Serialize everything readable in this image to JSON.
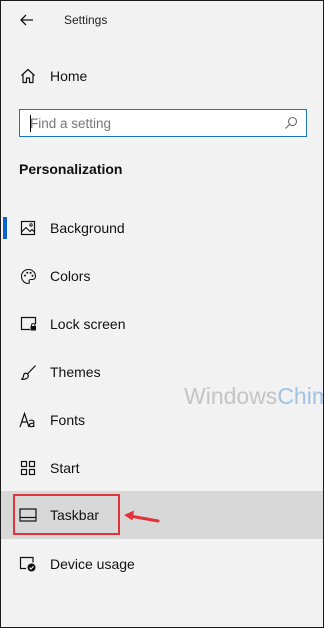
{
  "window": {
    "title": "Settings"
  },
  "nav": {
    "home_label": "Home"
  },
  "search": {
    "placeholder": "Find a setting"
  },
  "section": {
    "heading": "Personalization"
  },
  "menu": {
    "items": [
      {
        "label": "Background",
        "icon": "picture-icon"
      },
      {
        "label": "Colors",
        "icon": "palette-icon"
      },
      {
        "label": "Lock screen",
        "icon": "lock-screen-icon"
      },
      {
        "label": "Themes",
        "icon": "brush-icon"
      },
      {
        "label": "Fonts",
        "icon": "font-icon"
      },
      {
        "label": "Start",
        "icon": "start-grid-icon"
      },
      {
        "label": "Taskbar",
        "icon": "taskbar-icon"
      },
      {
        "label": "Device usage",
        "icon": "device-usage-icon"
      }
    ],
    "selected": "Background",
    "hovered": "Taskbar"
  },
  "watermark": {
    "part1": "Windows",
    "part2": "Chimp"
  },
  "colors": {
    "accent": "#0a63c9",
    "annotation": "#e0333a",
    "background": "#f2f2f2",
    "hover": "#d8d8d8"
  }
}
